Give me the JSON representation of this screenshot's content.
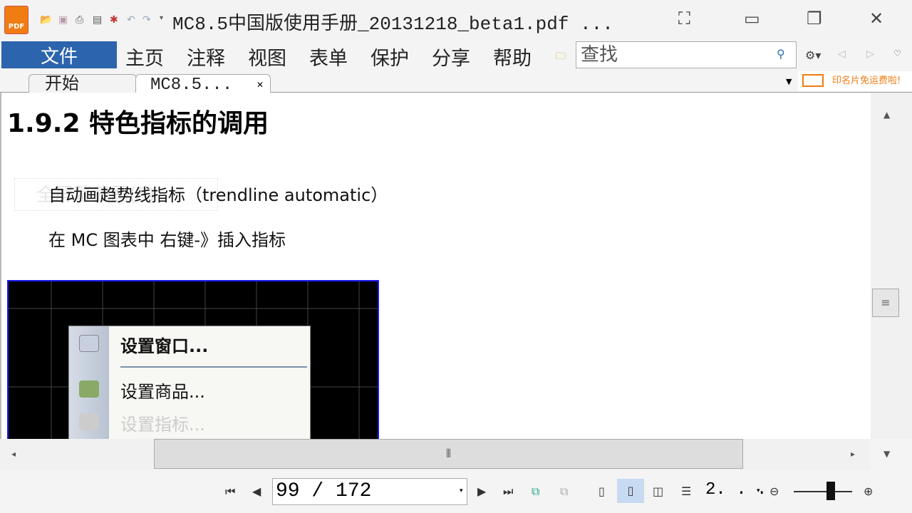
{
  "window": {
    "title": "MC8.5中国版使用手册_20131218_beta1.pdf ...",
    "logo_text": "PDF"
  },
  "menu": {
    "file": "文件",
    "items": [
      "主页",
      "注释",
      "视图",
      "表单",
      "保护",
      "分享",
      "帮助"
    ]
  },
  "search": {
    "placeholder": "查找"
  },
  "tabs": [
    {
      "label": "开始"
    },
    {
      "label": "MC8.5..."
    }
  ],
  "ad": {
    "text": "印名片免运费啦!"
  },
  "document": {
    "heading": "1.9.2  特色指标的调用",
    "para1": "自动画趋势线指标（trendline automatic）",
    "watermark": "全屏幕截图(5)",
    "para2": "在 MC 图表中  右键-》插入指标",
    "context_menu": [
      "设置窗口...",
      "设置商品...",
      "设置指标..."
    ]
  },
  "status": {
    "page_value": "99 / 172",
    "zoom": "2. . ."
  }
}
